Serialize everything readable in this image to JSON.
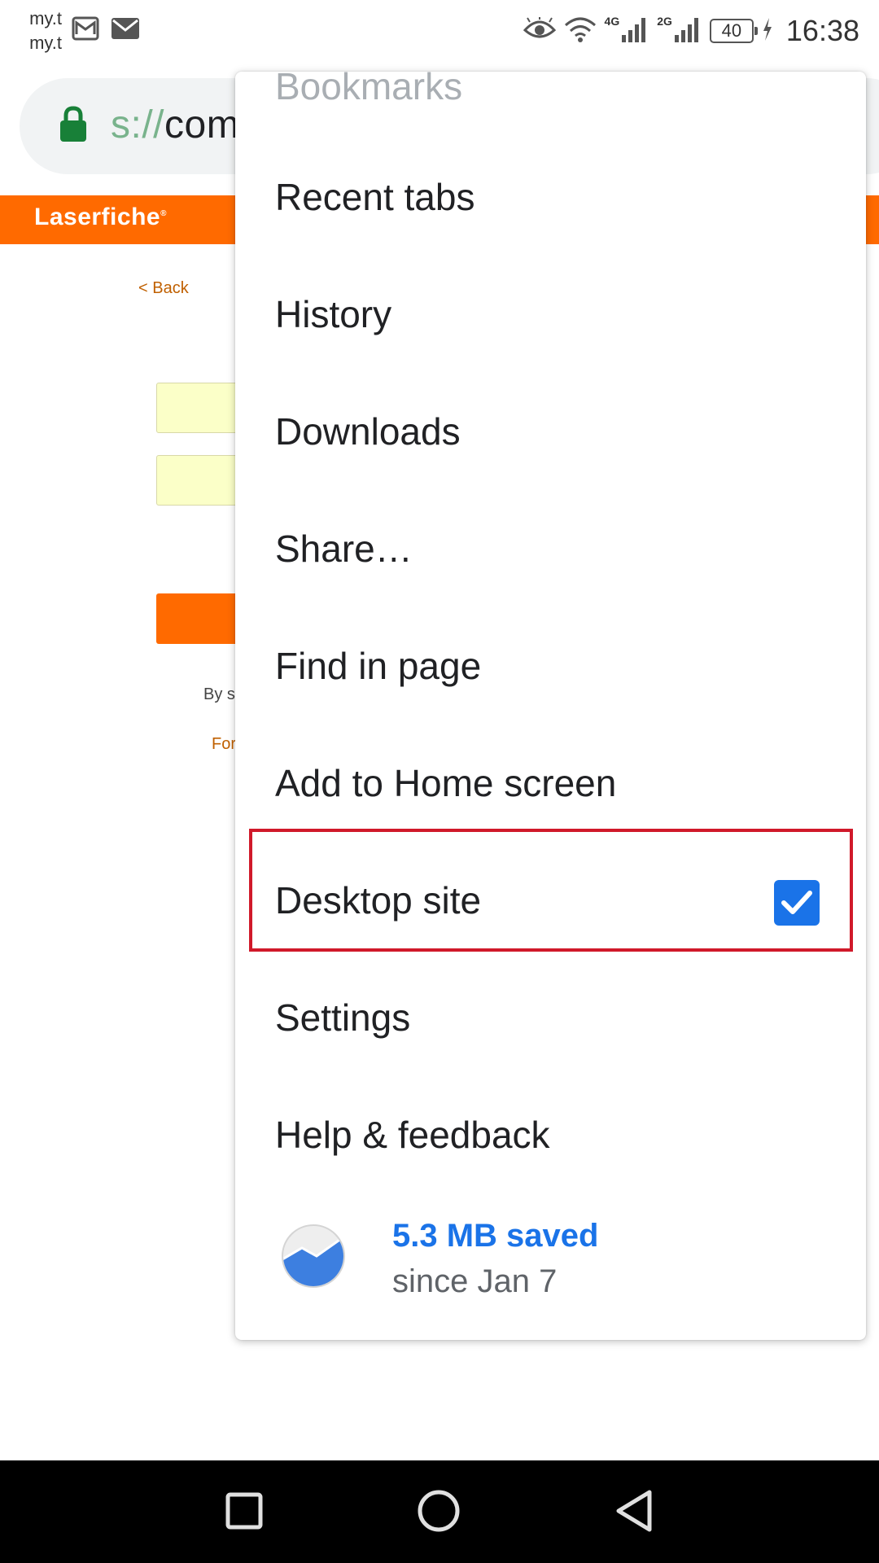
{
  "status_bar": {
    "carrier_lines": [
      "my.t",
      "my.t"
    ],
    "network_1": "4G",
    "network_2": "2G",
    "battery": "40",
    "time": "16:38"
  },
  "url_bar": {
    "scheme_fragment": "s://",
    "host_fragment": "com"
  },
  "page": {
    "logo": "Laserfiche",
    "back_link": "< Back",
    "terms_fragment": "By su",
    "forgot_fragment": "For",
    "brand_color": "#ff6a00"
  },
  "menu": {
    "partial_item": "Bookmarks",
    "items": [
      {
        "label": "Recent tabs"
      },
      {
        "label": "History"
      },
      {
        "label": "Downloads"
      },
      {
        "label": "Share…"
      },
      {
        "label": "Find in page"
      },
      {
        "label": "Add to Home screen"
      },
      {
        "label": "Desktop site",
        "checked": true
      },
      {
        "label": "Settings"
      },
      {
        "label": "Help & feedback"
      }
    ],
    "savings": {
      "amount": "5.3 MB saved",
      "since": "since Jan 7"
    },
    "accent_color": "#1a73e8",
    "highlight_color": "#d0192a"
  },
  "nav_bar": {
    "buttons": [
      "recents-icon",
      "home-icon",
      "back-icon"
    ]
  }
}
